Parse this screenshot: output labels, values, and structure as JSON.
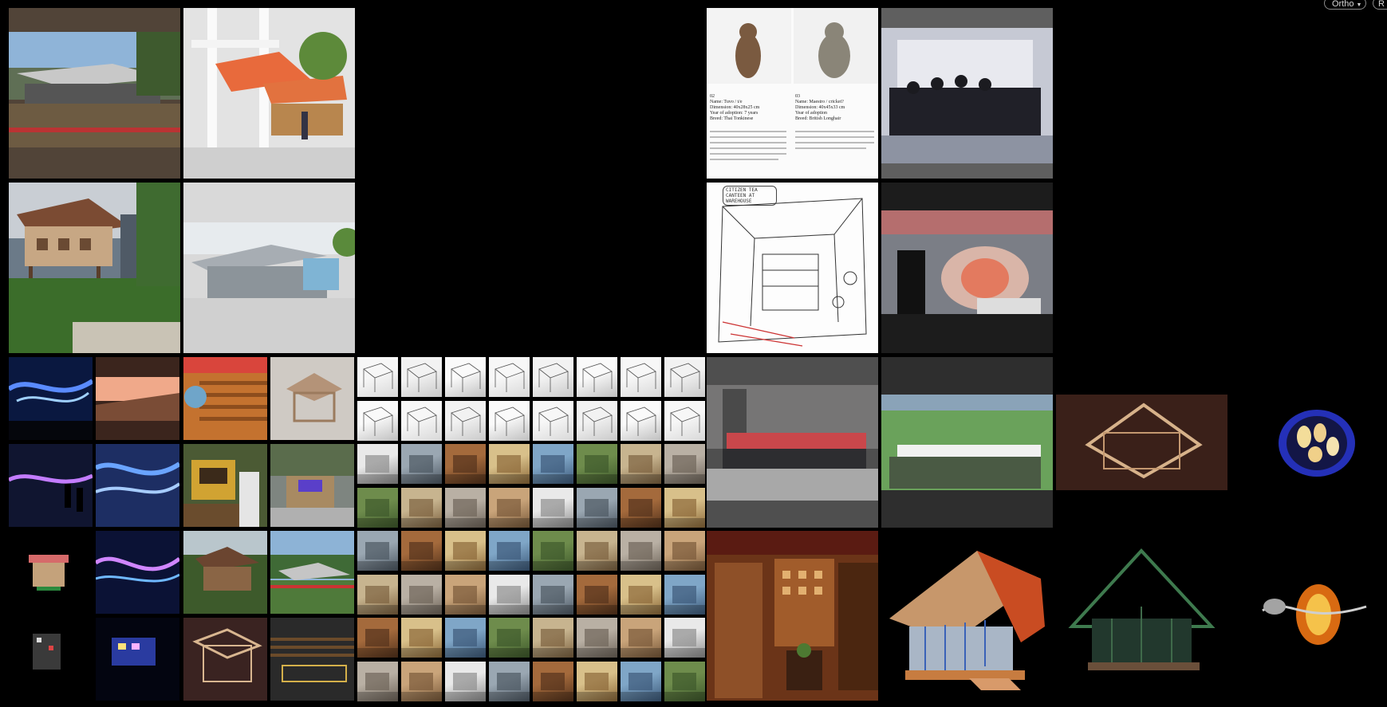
{
  "toolbar": {
    "view_mode_label": "Ortho",
    "second_button_label": "R"
  },
  "cat_card": {
    "cats": [
      {
        "number": "02",
        "name": "Name: Tuvo / t/e",
        "dims": "Dimension: 40x28x25 cm",
        "adopt": "Year of adoption: 7 years",
        "breed": "Breed: Thai Tonkinese"
      },
      {
        "number": "03",
        "name": "Name: Maestro / cricket?",
        "dims": "Dimension: 40x45x33 cm",
        "adopt": "Year of adoption",
        "breed": "Breed: British Longhair"
      }
    ]
  },
  "sketch_caption": "CITIZEN TEA CANTEEN AT WAREHOUSE",
  "colors": {
    "background": "#000000",
    "tile_placeholder": "#5a5a5a",
    "dark_placeholder": "#1c1c1c",
    "sky": "#9fc2e6",
    "foliage": "#3d6a2e",
    "wood": "#a2643a"
  }
}
